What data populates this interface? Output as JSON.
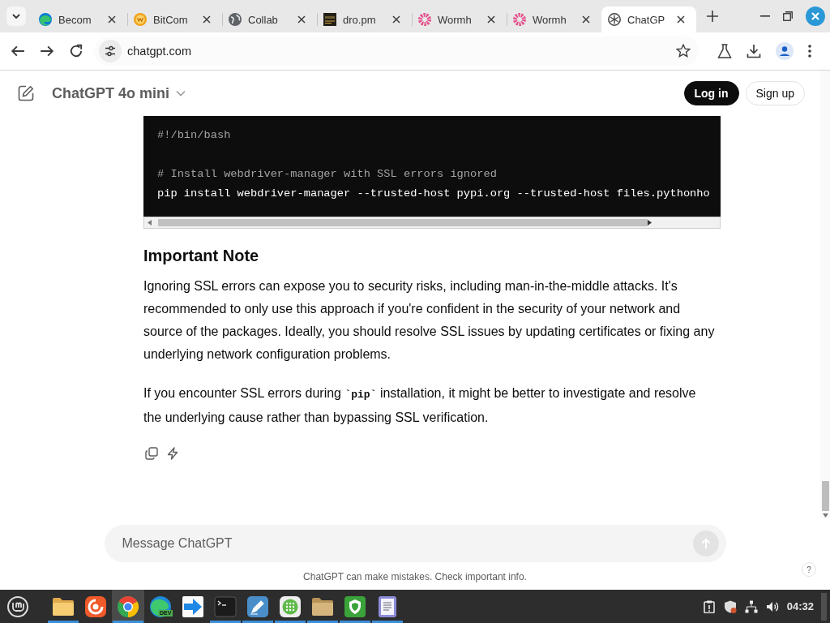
{
  "browser": {
    "tabs": [
      {
        "kind": "edge",
        "title": "Becom",
        "selected": false
      },
      {
        "kind": "bitcomet",
        "title": "BitCom",
        "selected": false
      },
      {
        "kind": "globe",
        "title": "Collab",
        "selected": false
      },
      {
        "kind": "thumbnail",
        "title": "dro.pm",
        "selected": false
      },
      {
        "kind": "wormhole",
        "title": "Wormh",
        "selected": false
      },
      {
        "kind": "wormhole",
        "title": "Wormh",
        "selected": false
      },
      {
        "kind": "chatgpt",
        "title": "ChatGP",
        "selected": true
      }
    ],
    "address_bar": {
      "url": "chatgpt.com"
    }
  },
  "page": {
    "header": {
      "model": "ChatGPT 4o mini",
      "login": "Log in",
      "signup": "Sign up"
    },
    "code_block": {
      "lines": [
        {
          "kind": "comment",
          "text": "#!/bin/bash"
        },
        {
          "kind": "blank"
        },
        {
          "kind": "comment",
          "text": "# Install webdriver-manager with SSL errors ignored"
        },
        {
          "kind": "code",
          "text": "pip install webdriver-manager --trusted-host pypi.org --trusted-host files.pythonho"
        }
      ]
    },
    "heading": "Important Note",
    "paragraphs": [
      "Ignoring SSL errors can expose you to security risks, including man-in-the-middle attacks. It's recommended to only use this approach if you're confident in the security of your network and source of the packages. Ideally, you should resolve SSL issues by updating certificates or fixing any underlying network configuration problems.",
      "If you encounter SSL errors during **`pip`** installation, it might be better to investigate and resolve the underlying cause rather than bypassing SSL verification."
    ],
    "composer": {
      "placeholder": "Message ChatGPT",
      "send_disabled": true
    },
    "disclaimer": "ChatGPT can make mistakes. Check important info.",
    "help": "?"
  },
  "taskbar": {
    "items": [
      {
        "kind": "files",
        "running": true,
        "selected": false
      },
      {
        "kind": "firefox",
        "running": false,
        "selected": false
      },
      {
        "kind": "chrome",
        "running": true,
        "selected": true
      },
      {
        "kind": "edge_dev",
        "badge": "DEV",
        "running": false,
        "selected": false
      },
      {
        "kind": "arrow",
        "running": false,
        "selected": false
      },
      {
        "kind": "terminal",
        "running": true,
        "selected": false
      },
      {
        "kind": "pen",
        "running": true,
        "selected": false
      },
      {
        "kind": "grid",
        "running": true,
        "selected": false
      },
      {
        "kind": "folder",
        "running": true,
        "selected": false
      },
      {
        "kind": "shield",
        "running": true,
        "selected": false
      },
      {
        "kind": "notes",
        "running": true,
        "selected": false
      }
    ],
    "clock": "04:32"
  }
}
